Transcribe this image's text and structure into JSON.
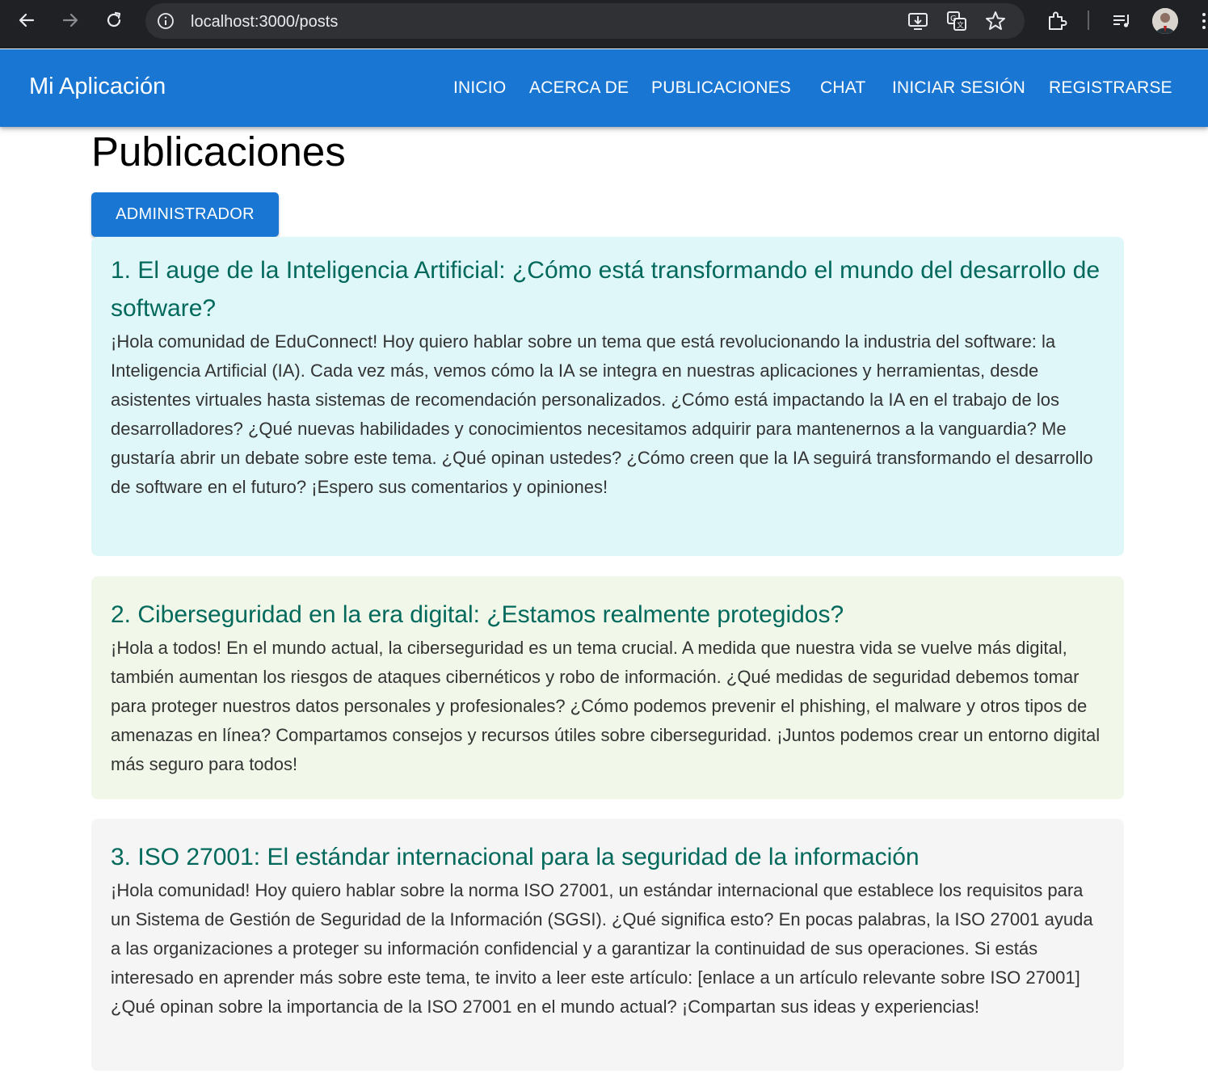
{
  "browser": {
    "url": "localhost:3000/posts"
  },
  "appbar": {
    "brand": "Mi Aplicación",
    "links": [
      "INICIO",
      "ACERCA DE",
      "PUBLICACIONES",
      "CHAT",
      "INICIAR SESIÓN",
      "REGISTRARSE"
    ]
  },
  "main": {
    "title": "Publicaciones",
    "admin_button": "ADMINISTRADOR",
    "posts": [
      {
        "title": "1. El auge de la Inteligencia Artificial: ¿Cómo está transformando el mundo del desarrollo de software?",
        "body": "¡Hola comunidad de EduConnect! Hoy quiero hablar sobre un tema que está revolucionando la industria del software: la Inteligencia Artificial (IA). Cada vez más, vemos cómo la IA se integra en nuestras aplicaciones y herramientas, desde asistentes virtuales hasta sistemas de recomendación personalizados. ¿Cómo está impactando la IA en el trabajo de los desarrolladores? ¿Qué nuevas habilidades y conocimientos necesitamos adquirir para mantenernos a la vanguardia? Me gustaría abrir un debate sobre este tema. ¿Qué opinan ustedes? ¿Cómo creen que la IA seguirá transformando el desarrollo de software en el futuro? ¡Espero sus comentarios y opiniones!",
        "color": "#e0f7fa"
      },
      {
        "title": "2. Ciberseguridad en la era digital: ¿Estamos realmente protegidos?",
        "body": "¡Hola a todos! En el mundo actual, la ciberseguridad es un tema crucial. A medida que nuestra vida se vuelve más digital, también aumentan los riesgos de ataques cibernéticos y robo de información. ¿Qué medidas de seguridad debemos tomar para proteger nuestros datos personales y profesionales? ¿Cómo podemos prevenir el phishing, el malware y otros tipos de amenazas en línea? Compartamos consejos y recursos útiles sobre ciberseguridad. ¡Juntos podemos crear un entorno digital más seguro para todos!",
        "color": "#f1f8e9"
      },
      {
        "title": "3. ISO 27001: El estándar internacional para la seguridad de la información",
        "body": "¡Hola comunidad! Hoy quiero hablar sobre la norma ISO 27001, un estándar internacional que establece los requisitos para un Sistema de Gestión de Seguridad de la Información (SGSI). ¿Qué significa esto? En pocas palabras, la ISO 27001 ayuda a las organizaciones a proteger su información confidencial y a garantizar la continuidad de sus operaciones. Si estás interesado en aprender más sobre este tema, te invito a leer este artículo: [enlace a un artículo relevante sobre ISO 27001] ¿Qué opinan sobre la importancia de la ISO 27001 en el mundo actual? ¡Compartan sus ideas y experiencias!",
        "color": "#f5f5f5"
      }
    ]
  }
}
